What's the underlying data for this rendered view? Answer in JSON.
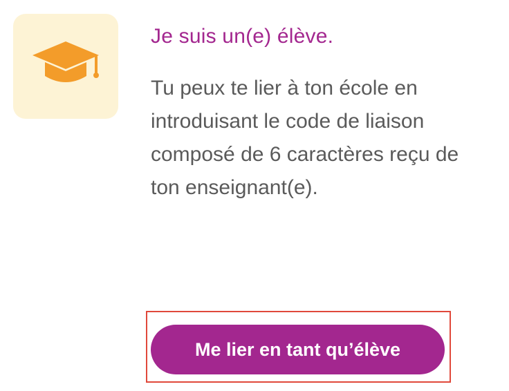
{
  "card": {
    "icon": "graduation-cap-icon",
    "title": "Je suis un(e) élève.",
    "description": "Tu peux te lier à ton école en introduisant le code de liaison composé de 6 caractères reçu de ton enseignant(e).",
    "button_label": "Me lier en tant qu’élève"
  },
  "colors": {
    "accent": "#a3278f",
    "icon": "#f39c2a",
    "icon_tile": "#fdf3d5",
    "text": "#5a5a5a",
    "highlight": "#e0483a"
  }
}
